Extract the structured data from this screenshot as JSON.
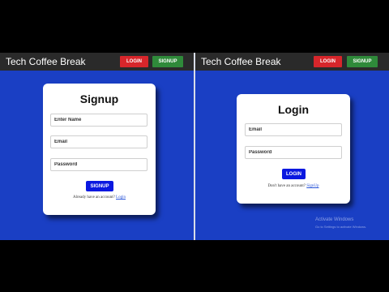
{
  "left": {
    "brand": "Tech Coffee Break",
    "nav": {
      "login": "LOGIN",
      "signup": "SIGNUP"
    },
    "card": {
      "title": "Signup",
      "fields": [
        {
          "placeholder": "Enter Name"
        },
        {
          "placeholder": "Email"
        },
        {
          "placeholder": "Password"
        }
      ],
      "button": "SIGNUP",
      "footer_text": "Already have an account?",
      "footer_link": "Login"
    }
  },
  "right": {
    "brand": "Tech Coffee Break",
    "nav": {
      "login": "LOGIN",
      "signup": "SIGNUP"
    },
    "card": {
      "title": "Login",
      "fields": [
        {
          "placeholder": "Email"
        },
        {
          "placeholder": "Password"
        }
      ],
      "button": "LOGIN",
      "footer_text": "Don't have an account?",
      "footer_link": "SignUp"
    }
  },
  "watermark": {
    "title": "Activate Windows",
    "subtitle": "Go to Settings to activate Windows."
  },
  "colors": {
    "background_blue": "#1a3fc4",
    "topbar": "#2a2a2a",
    "login_red": "#d7262b",
    "signup_green": "#2f8a3a",
    "action_blue": "#0a18e0"
  }
}
